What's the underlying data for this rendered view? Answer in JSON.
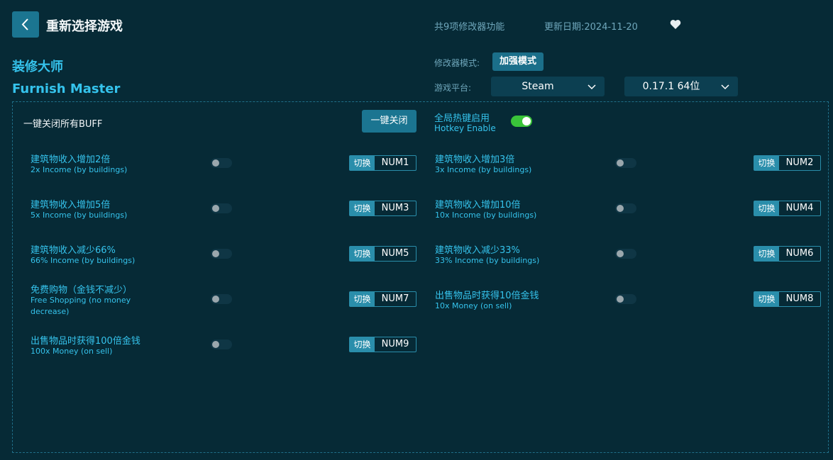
{
  "header": {
    "title": "重新选择游戏",
    "feature_count": "共9项修改器功能",
    "update_date": "更新日期:2024-11-20",
    "heart_icon": "heart-icon",
    "back_icon": "chevron-left-icon"
  },
  "game": {
    "name_cn": "装修大师",
    "name_en": "Furnish Master"
  },
  "settings": {
    "mode_label": "修改器模式:",
    "mode_value": "加强模式",
    "platform_label": "游戏平台:",
    "platform_value": "Steam",
    "version_value": "0.17.1 64位"
  },
  "controls": {
    "all_off_label": "一键关闭所有BUFF",
    "all_off_button": "一键关闭",
    "hotkey_cn": "全局热键启用",
    "hotkey_en": "Hotkey Enable",
    "hotkey_enabled": true
  },
  "features": [
    {
      "cn": "建筑物收入增加2倍",
      "en": "2x Income (by buildings)",
      "switch": "切换",
      "key": "NUM1",
      "on": false
    },
    {
      "cn": "建筑物收入增加3倍",
      "en": "3x Income (by buildings)",
      "switch": "切换",
      "key": "NUM2",
      "on": false
    },
    {
      "cn": "建筑物收入增加5倍",
      "en": "5x Income (by buildings)",
      "switch": "切换",
      "key": "NUM3",
      "on": false
    },
    {
      "cn": "建筑物收入增加10倍",
      "en": "10x Income (by buildings)",
      "switch": "切换",
      "key": "NUM4",
      "on": false
    },
    {
      "cn": "建筑物收入减少66%",
      "en": "66% Income (by buildings)",
      "switch": "切换",
      "key": "NUM5",
      "on": false
    },
    {
      "cn": "建筑物收入减少33%",
      "en": "33% Income (by buildings)",
      "switch": "切换",
      "key": "NUM6",
      "on": false
    },
    {
      "cn": "免费购物（金钱不减少）",
      "en": "Free Shopping (no money decrease)",
      "switch": "切换",
      "key": "NUM7",
      "on": false
    },
    {
      "cn": "出售物品时获得10倍金钱",
      "en": "10x Money (on sell)",
      "switch": "切换",
      "key": "NUM8",
      "on": false
    },
    {
      "cn": "出售物品时获得100倍金钱",
      "en": "100x Money (on sell)",
      "switch": "切换",
      "key": "NUM9",
      "on": false
    }
  ]
}
